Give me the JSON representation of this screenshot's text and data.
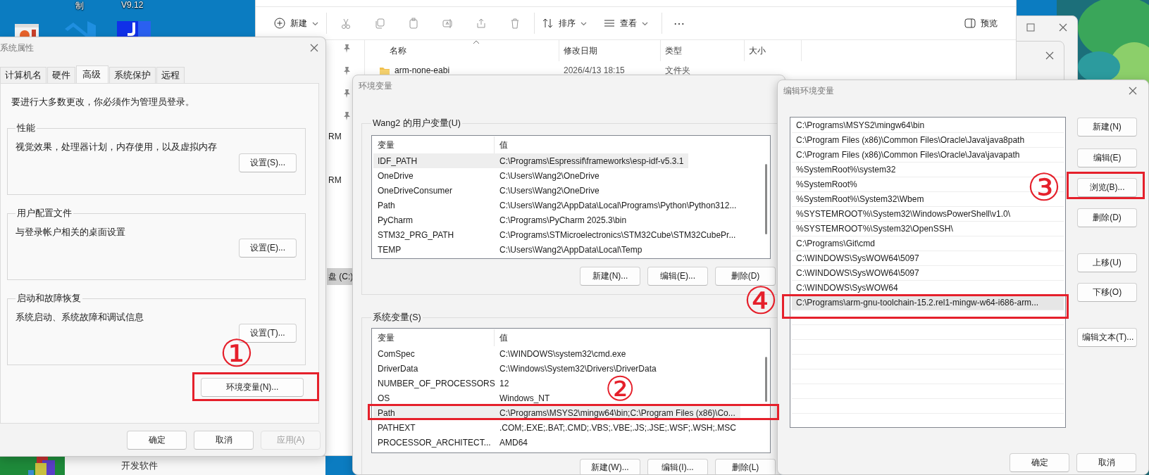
{
  "desktop": {
    "icon_labels": [
      "制",
      "V9.12"
    ],
    "background_window": {
      "label": "开发软件"
    }
  },
  "file_explorer": {
    "toolbar": {
      "new": "新建",
      "sort": "排序",
      "view": "查看",
      "more": "⋯",
      "preview": "预览"
    },
    "nav_fragments": [
      {
        "label": "RM",
        "selected": false
      },
      {
        "label": "RM",
        "selected": false
      },
      {
        "label": "盘 (C:)",
        "selected": true
      }
    ],
    "columns": [
      "名称",
      "修改日期",
      "类型",
      "大小"
    ],
    "rows": [
      {
        "name": "arm-none-eabi",
        "modified": "2026/4/13 18:15",
        "type": "文件夹"
      }
    ]
  },
  "system_properties": {
    "title": "系统属性",
    "tabs": [
      {
        "label": "计算机名",
        "selected": false
      },
      {
        "label": "硬件",
        "selected": false
      },
      {
        "label": "高级",
        "selected": true
      },
      {
        "label": "系统保护",
        "selected": false
      },
      {
        "label": "远程",
        "selected": false
      }
    ],
    "notice": "要进行大多数更改，你必须作为管理员登录。",
    "groups": [
      {
        "title": "性能",
        "description": "视觉效果，处理器计划，内存使用，以及虚拟内存",
        "button": "设置(S)..."
      },
      {
        "title": "用户配置文件",
        "description": "与登录帐户相关的桌面设置",
        "button": "设置(E)..."
      },
      {
        "title": "启动和故障恢复",
        "description": "系统启动、系统故障和调试信息",
        "button": "设置(T)..."
      }
    ],
    "env_button": "环境变量(N)...",
    "buttons": [
      {
        "label": "确定",
        "disabled": false
      },
      {
        "label": "取消",
        "disabled": false
      },
      {
        "label": "应用(A)",
        "disabled": true
      }
    ]
  },
  "environment_variables": {
    "title": "环境变量",
    "groups": [
      {
        "title": "Wang2 的用户变量(U)",
        "columns": [
          "变量",
          "值"
        ],
        "rows": [
          {
            "name": "IDF_PATH",
            "value": "C:\\Programs\\Espressif\\frameworks\\esp-idf-v5.3.1",
            "selected": true
          },
          {
            "name": "OneDrive",
            "value": "C:\\Users\\Wang2\\OneDrive",
            "selected": false
          },
          {
            "name": "OneDriveConsumer",
            "value": "C:\\Users\\Wang2\\OneDrive",
            "selected": false
          },
          {
            "name": "Path",
            "value": "C:\\Users\\Wang2\\AppData\\Local\\Programs\\Python\\Python312...",
            "selected": false
          },
          {
            "name": "PyCharm",
            "value": "C:\\Programs\\PyCharm 2025.3\\bin",
            "selected": false
          },
          {
            "name": "STM32_PRG_PATH",
            "value": "C:\\Programs\\STMicroelectronics\\STM32Cube\\STM32CubePr...",
            "selected": false
          },
          {
            "name": "TEMP",
            "value": "C:\\Users\\Wang2\\AppData\\Local\\Temp",
            "selected": false
          }
        ],
        "buttons": [
          "新建(N)...",
          "编辑(E)...",
          "删除(D)"
        ]
      },
      {
        "title": "系统变量(S)",
        "columns": [
          "变量",
          "值"
        ],
        "rows": [
          {
            "name": "ComSpec",
            "value": "C:\\WINDOWS\\system32\\cmd.exe",
            "selected": false
          },
          {
            "name": "DriverData",
            "value": "C:\\Windows\\System32\\Drivers\\DriverData",
            "selected": false
          },
          {
            "name": "NUMBER_OF_PROCESSORS",
            "value": "12",
            "selected": false
          },
          {
            "name": "OS",
            "value": "Windows_NT",
            "selected": false
          },
          {
            "name": "Path",
            "value": "C:\\Programs\\MSYS2\\mingw64\\bin;C:\\Program Files (x86)\\Co...",
            "selected": true
          },
          {
            "name": "PATHEXT",
            "value": ".COM;.EXE;.BAT;.CMD;.VBS;.VBE;.JS;.JSE;.WSF;.WSH;.MSC",
            "selected": false
          },
          {
            "name": "PROCESSOR_ARCHITECT...",
            "value": "AMD64",
            "selected": false
          }
        ],
        "buttons": [
          "新建(W)...",
          "编辑(I)...",
          "删除(L)"
        ]
      }
    ]
  },
  "edit_variable": {
    "title": "编辑环境变量",
    "entries": [
      {
        "text": "C:\\Programs\\MSYS2\\mingw64\\bin",
        "selected": false
      },
      {
        "text": "C:\\Program Files (x86)\\Common Files\\Oracle\\Java\\java8path",
        "selected": false
      },
      {
        "text": "C:\\Program Files (x86)\\Common Files\\Oracle\\Java\\javapath",
        "selected": false
      },
      {
        "text": "%SystemRoot%\\system32",
        "selected": false
      },
      {
        "text": "%SystemRoot%",
        "selected": false
      },
      {
        "text": "%SystemRoot%\\System32\\Wbem",
        "selected": false
      },
      {
        "text": "%SYSTEMROOT%\\System32\\WindowsPowerShell\\v1.0\\",
        "selected": false
      },
      {
        "text": "%SYSTEMROOT%\\System32\\OpenSSH\\",
        "selected": false
      },
      {
        "text": "C:\\Programs\\Git\\cmd",
        "selected": false
      },
      {
        "text": "C:\\WINDOWS\\SysWOW64\\5097",
        "selected": false
      },
      {
        "text": "C:\\WINDOWS\\SysWOW64\\5097",
        "selected": false
      },
      {
        "text": "C:\\WINDOWS\\SysWOW64",
        "selected": false
      },
      {
        "text": "C:\\Programs\\arm-gnu-toolchain-15.2.rel1-mingw-w64-i686-arm...",
        "selected": true
      }
    ],
    "side_buttons": [
      "新建(N)",
      "编辑(E)",
      "浏览(B)...",
      "删除(D)",
      "上移(U)",
      "下移(O)",
      "编辑文本(T)..."
    ],
    "buttons": [
      "确定",
      "取消"
    ]
  },
  "annotations": [
    {
      "label": "①"
    },
    {
      "label": "②"
    },
    {
      "label": "③"
    },
    {
      "label": "④"
    }
  ]
}
